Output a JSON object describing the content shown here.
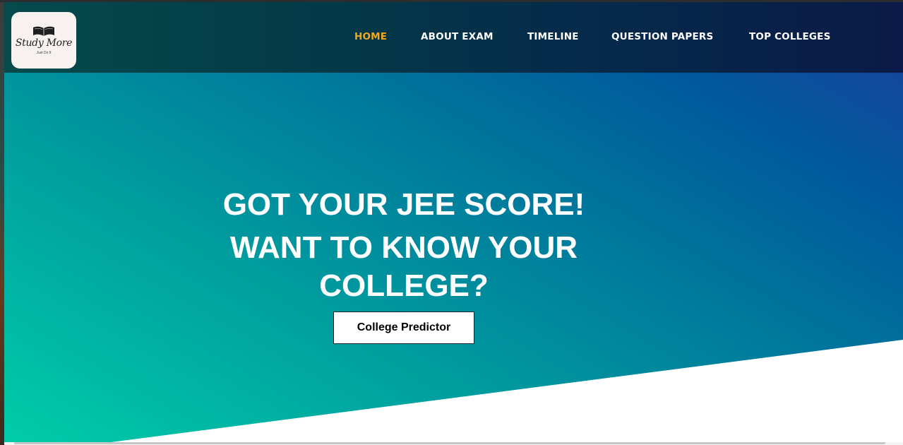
{
  "logo": {
    "name": "Study More",
    "tagline": "Just Do It"
  },
  "nav": {
    "items": [
      {
        "label": "HOME",
        "active": true
      },
      {
        "label": "ABOUT EXAM",
        "active": false
      },
      {
        "label": "TIMELINE",
        "active": false
      },
      {
        "label": "QUESTION PAPERS",
        "active": false
      },
      {
        "label": "TOP COLLEGES",
        "active": false
      }
    ]
  },
  "hero": {
    "line1": "GOT YOUR JEE SCORE!",
    "line2": "WANT TO KNOW YOUR COLLEGE?",
    "cta_label": "College Predictor"
  },
  "colors": {
    "active_nav": "#f2a81d",
    "nav_text": "#ffffff",
    "hero_start": "#00cda8",
    "hero_end": "#1d3e9c"
  }
}
